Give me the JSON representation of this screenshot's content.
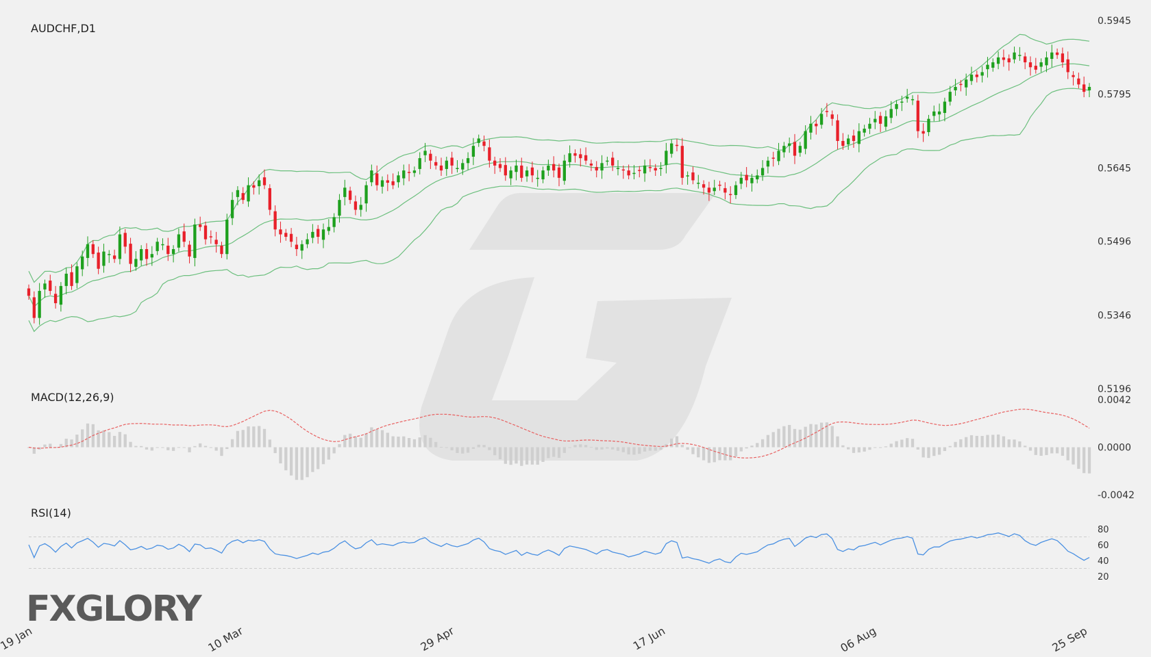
{
  "panels": {
    "main_title": "AUDCHF,D1",
    "macd_title": "MACD(12,26,9)",
    "rsi_title": "RSI(14)"
  },
  "logo": {
    "text_left": "FX",
    "text_right": "GLORY"
  },
  "colors": {
    "bull": "#1ea01e",
    "bear": "#e8202a",
    "bands": "#6bbf7d",
    "macd_signal": "#e86060",
    "macd_hist": "#cfcfcf",
    "rsi_line": "#4a90e2",
    "grid": "#cccccc",
    "watermark": "#e2e2e2"
  },
  "chart_data": [
    {
      "type": "candlestick",
      "title": "AUDCHF,D1",
      "y_ticks": [
        "0.5945",
        "0.5795",
        "0.5645",
        "0.5496",
        "0.5346",
        "0.5196"
      ],
      "ylim": [
        0.5196,
        0.5945
      ],
      "x_ticks": [
        "19 Jan",
        "10 Mar",
        "29 Apr",
        "17 Jun",
        "06 Aug",
        "25 Sep"
      ],
      "close": [
        0.5385,
        0.534,
        0.5395,
        0.541,
        0.5395,
        0.537,
        0.5405,
        0.543,
        0.5405,
        0.5445,
        0.5465,
        0.549,
        0.547,
        0.544,
        0.5475,
        0.547,
        0.546,
        0.551,
        0.5485,
        0.545,
        0.546,
        0.548,
        0.546,
        0.547,
        0.5495,
        0.549,
        0.547,
        0.548,
        0.551,
        0.5495,
        0.5465,
        0.553,
        0.5525,
        0.55,
        0.5505,
        0.549,
        0.547,
        0.554,
        0.558,
        0.56,
        0.558,
        0.561,
        0.5605,
        0.562,
        0.561,
        0.556,
        0.552,
        0.551,
        0.5505,
        0.5495,
        0.548,
        0.549,
        0.55,
        0.5515,
        0.5505,
        0.552,
        0.5525,
        0.5545,
        0.558,
        0.5605,
        0.558,
        0.556,
        0.557,
        0.561,
        0.564,
        0.561,
        0.562,
        0.5615,
        0.561,
        0.563,
        0.564,
        0.5635,
        0.564,
        0.5665,
        0.568,
        0.566,
        0.565,
        0.564,
        0.566,
        0.565,
        0.5645,
        0.5655,
        0.5665,
        0.569,
        0.5705,
        0.569,
        0.566,
        0.565,
        0.5645,
        0.563,
        0.564,
        0.565,
        0.5625,
        0.564,
        0.563,
        0.5625,
        0.564,
        0.565,
        0.564,
        0.5625,
        0.566,
        0.5675,
        0.567,
        0.5665,
        0.566,
        0.565,
        0.564,
        0.5655,
        0.566,
        0.565,
        0.5645,
        0.564,
        0.563,
        0.5635,
        0.564,
        0.565,
        0.5645,
        0.564,
        0.5645,
        0.568,
        0.5695,
        0.569,
        0.5625,
        0.563,
        0.562,
        0.5615,
        0.5605,
        0.5595,
        0.5605,
        0.561,
        0.5595,
        0.559,
        0.561,
        0.5625,
        0.562,
        0.5625,
        0.563,
        0.5645,
        0.566,
        0.5665,
        0.568,
        0.569,
        0.5695,
        0.567,
        0.569,
        0.572,
        0.5735,
        0.573,
        0.5755,
        0.576,
        0.5745,
        0.57,
        0.569,
        0.5705,
        0.57,
        0.572,
        0.5725,
        0.5735,
        0.5745,
        0.5735,
        0.575,
        0.5765,
        0.5775,
        0.578,
        0.579,
        0.5785,
        0.572,
        0.5715,
        0.5745,
        0.576,
        0.576,
        0.578,
        0.58,
        0.581,
        0.5815,
        0.5825,
        0.5835,
        0.583,
        0.584,
        0.5855,
        0.586,
        0.587,
        0.5865,
        0.586,
        0.588,
        0.5875,
        0.586,
        0.585,
        0.5845,
        0.586,
        0.587,
        0.588,
        0.5875,
        0.586,
        0.584,
        0.583,
        0.5815,
        0.58,
        0.581
      ]
    },
    {
      "type": "line",
      "title": "MACD(12,26,9)",
      "y_ticks": [
        "0.0042",
        "0.0000",
        "-0.0042"
      ],
      "ylim": [
        -0.0042,
        0.0042
      ]
    },
    {
      "type": "line",
      "title": "RSI(14)",
      "y_ticks": [
        "80",
        "60",
        "40",
        "20"
      ],
      "ylim": [
        20,
        80
      ],
      "levels": [
        30,
        70
      ]
    }
  ]
}
